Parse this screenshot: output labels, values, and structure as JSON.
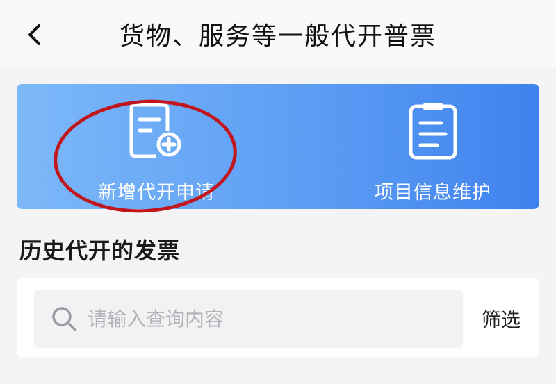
{
  "header": {
    "title": "货物、服务等一般代开普票",
    "back_icon": "chevron-left-icon"
  },
  "banner": {
    "actions": [
      {
        "label": "新增代开申请",
        "icon": "document-add-icon"
      },
      {
        "label": "项目信息维护",
        "icon": "clipboard-list-icon"
      }
    ],
    "colors": {
      "gradient_start": "#7db8f8",
      "gradient_end": "#3f82ee",
      "text": "#ffffff"
    }
  },
  "history": {
    "title": "历史代开的发票",
    "search": {
      "placeholder": "请输入查询内容",
      "value": "",
      "icon": "search-icon"
    },
    "filter_label": "筛选"
  },
  "annotation": {
    "highlight_color": "#c0161c"
  }
}
